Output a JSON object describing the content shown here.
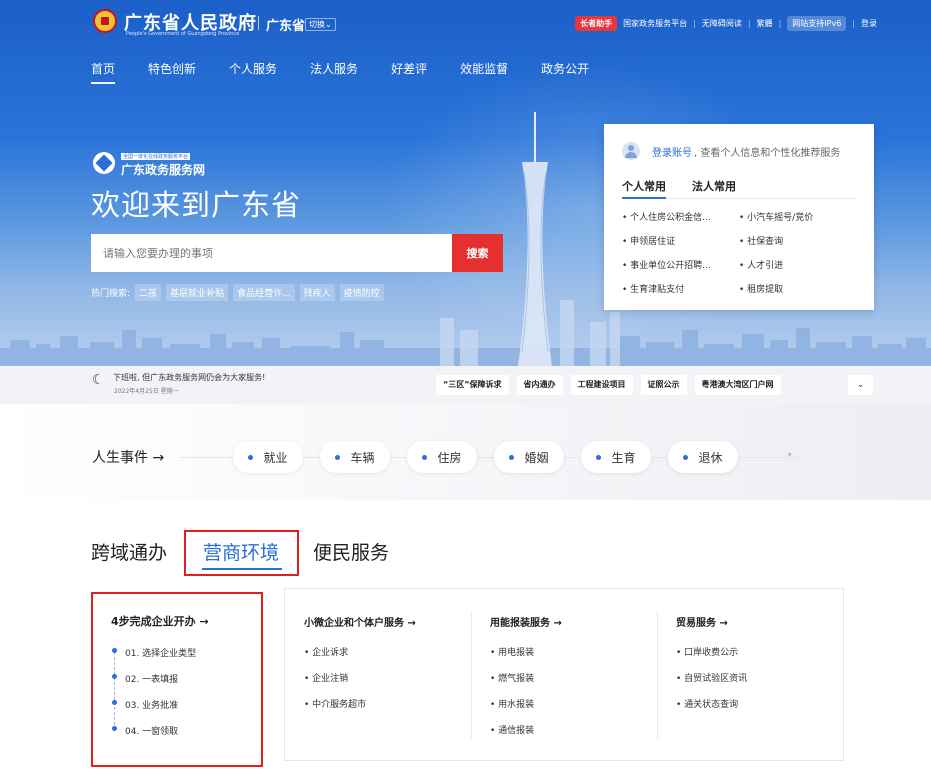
{
  "header": {
    "gov_title": "广东省人民政府",
    "gov_subtitle": "People's Government of Guangdong Province",
    "province": "广东省",
    "switch_label": "切换⌄",
    "links": [
      "长者助手",
      "国家政务服务平台",
      "无障碍阅读",
      "繁體",
      "网站支持IPv6",
      "登录"
    ]
  },
  "nav": [
    "首页",
    "特色创新",
    "个人服务",
    "法人服务",
    "好差评",
    "效能监督",
    "政务公开"
  ],
  "hero": {
    "logo_small": "全国一体化在线政务服务平台",
    "logo_big": "广东政务服务网",
    "welcome": "欢迎来到广东省",
    "search_placeholder": "请输入您要办理的事项",
    "search_button": "搜索",
    "hot_label": "热门搜索:",
    "hot_tags": [
      "二孩",
      "基层就业补贴",
      "食品经营许...",
      "残疾人",
      "疫情防控"
    ]
  },
  "login_card": {
    "login_link": "登录账号",
    "login_text": ", 查看个人信息和个性化推荐服务",
    "tabs": [
      "个人常用",
      "法人常用"
    ],
    "items": [
      "个人住房公积金信...",
      "小汽车摇号/竞价",
      "申领居住证",
      "社保查询",
      "事业单位公开招聘...",
      "人才引进",
      "生育津贴支付",
      "租房提取"
    ]
  },
  "notice": {
    "message": "下班啦, 但广东政务服务网仍会为大家服务!",
    "date": "2022年4月25日 星期一",
    "quick_links": [
      "“三区”保障诉求",
      "省内通办",
      "工程建设项目",
      "证照公示",
      "粤港澳大湾区门户网"
    ],
    "more": "⌄"
  },
  "life_events": {
    "title": "人生事件 →",
    "items": [
      "就业",
      "车辆",
      "住房",
      "婚姻",
      "生育",
      "退休"
    ],
    "arrow": "›"
  },
  "section_tabs": [
    "跨域通办",
    "营商环境",
    "便民服务"
  ],
  "startup": {
    "title": "4步完成企业开办 →",
    "steps": [
      "01. 选择企业类型",
      "02. 一表填报",
      "03. 业务批准",
      "04. 一窗领取"
    ]
  },
  "services": [
    {
      "title": "小微企业和个体户服务 →",
      "items": [
        "企业诉求",
        "企业注销",
        "中介服务超市"
      ]
    },
    {
      "title": "用能报装服务 →",
      "items": [
        "用电报装",
        "燃气报装",
        "用水报装",
        "通信报装"
      ]
    },
    {
      "title": "贸易服务 →",
      "items": [
        "口岸收费公示",
        "自贸试验区资讯",
        "通关状态查询"
      ]
    }
  ],
  "colors": {
    "primary": "#2a6ed6",
    "search_red": "#e62f2f",
    "highlight_red": "#e02020"
  }
}
